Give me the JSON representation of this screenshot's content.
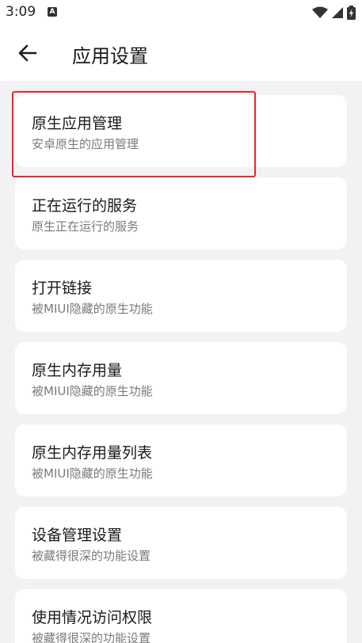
{
  "status_bar": {
    "time": "3:09",
    "notification_icon": "A",
    "icons": [
      "wifi-icon",
      "signal-icon",
      "battery-charging-icon"
    ]
  },
  "header": {
    "title": "应用设置",
    "back_icon": "arrow-left-icon"
  },
  "items": [
    {
      "title": "原生应用管理",
      "subtitle": "安卓原生的应用管理"
    },
    {
      "title": "正在运行的服务",
      "subtitle": "原生正在运行的服务"
    },
    {
      "title": "打开链接",
      "subtitle": "被MIUI隐藏的原生功能"
    },
    {
      "title": "原生内存用量",
      "subtitle": "被MIUI隐藏的原生功能"
    },
    {
      "title": "原生内存用量列表",
      "subtitle": "被MIUI隐藏的原生功能"
    },
    {
      "title": "设备管理设置",
      "subtitle": "被藏得很深的功能设置"
    },
    {
      "title": "使用情况访问权限",
      "subtitle": "被藏得很深的功能设置"
    }
  ],
  "colors": {
    "background": "#f2f2f4",
    "card": "#ffffff",
    "highlight": "#e8282c",
    "title_text": "#1a1a1a",
    "subtitle_text": "#7a7a7a"
  }
}
